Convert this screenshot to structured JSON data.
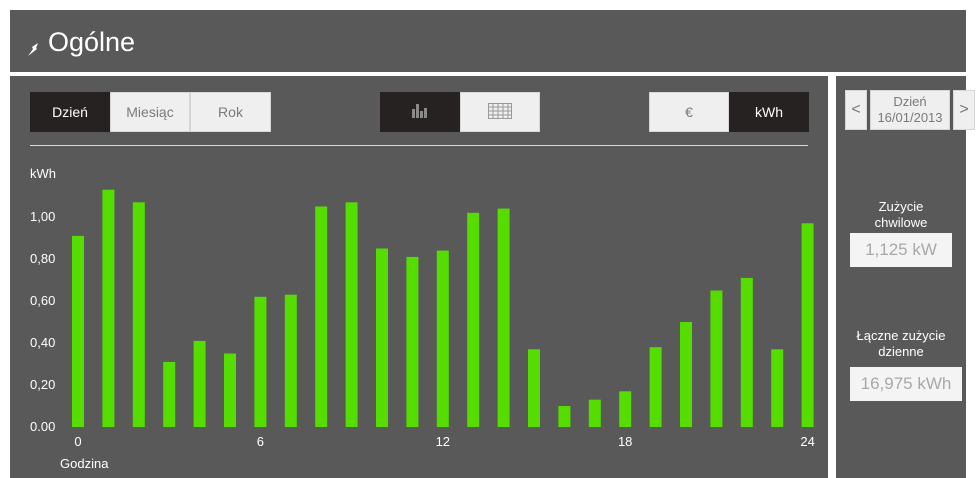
{
  "header": {
    "title": "Ogólne",
    "icon": "plug-icon"
  },
  "period_tabs": {
    "day": "Dzień",
    "month": "Miesiąc",
    "year": "Rok",
    "active": "day"
  },
  "view_toggle": {
    "chart_icon": "bar-chart-icon",
    "table_icon": "table-grid-icon",
    "active": "chart"
  },
  "unit_toggle": {
    "euro": "€",
    "kwh": "kWh",
    "active": "kwh"
  },
  "date_nav": {
    "prev": "<",
    "next": ">",
    "period": "Dzień",
    "date": "16/01/2013"
  },
  "stats": {
    "instant_label": "Zużycie chwilowe",
    "instant_value": "1,125 kW",
    "daily_label": "Łączne zużycie dzienne",
    "daily_value": "16,975 kWh"
  },
  "colors": {
    "bar": "#55dd00",
    "panel": "#595959",
    "active_button": "#272222"
  },
  "chart_data": {
    "type": "bar",
    "ylabel": "kWh",
    "xlabel": "Godzina",
    "ylim": [
      0,
      1.1
    ],
    "y_ticks": [
      "0.00",
      "0,20",
      "0,40",
      "0,60",
      "0,80",
      "1,00"
    ],
    "x_ticks": [
      "0",
      "6",
      "12",
      "18",
      "24"
    ],
    "hours": [
      1,
      2,
      3,
      4,
      5,
      6,
      7,
      8,
      9,
      10,
      11,
      12,
      13,
      14,
      15,
      16,
      17,
      18,
      19,
      20,
      21,
      22,
      23,
      24
    ],
    "values": [
      0.91,
      1.13,
      1.07,
      0.31,
      0.41,
      0.35,
      0.62,
      0.63,
      1.05,
      1.07,
      0.85,
      0.81,
      0.84,
      1.02,
      1.04,
      0.37,
      0.1,
      0.13,
      0.17,
      0.38,
      0.5,
      0.65,
      0.71,
      0.37,
      0.97
    ]
  }
}
